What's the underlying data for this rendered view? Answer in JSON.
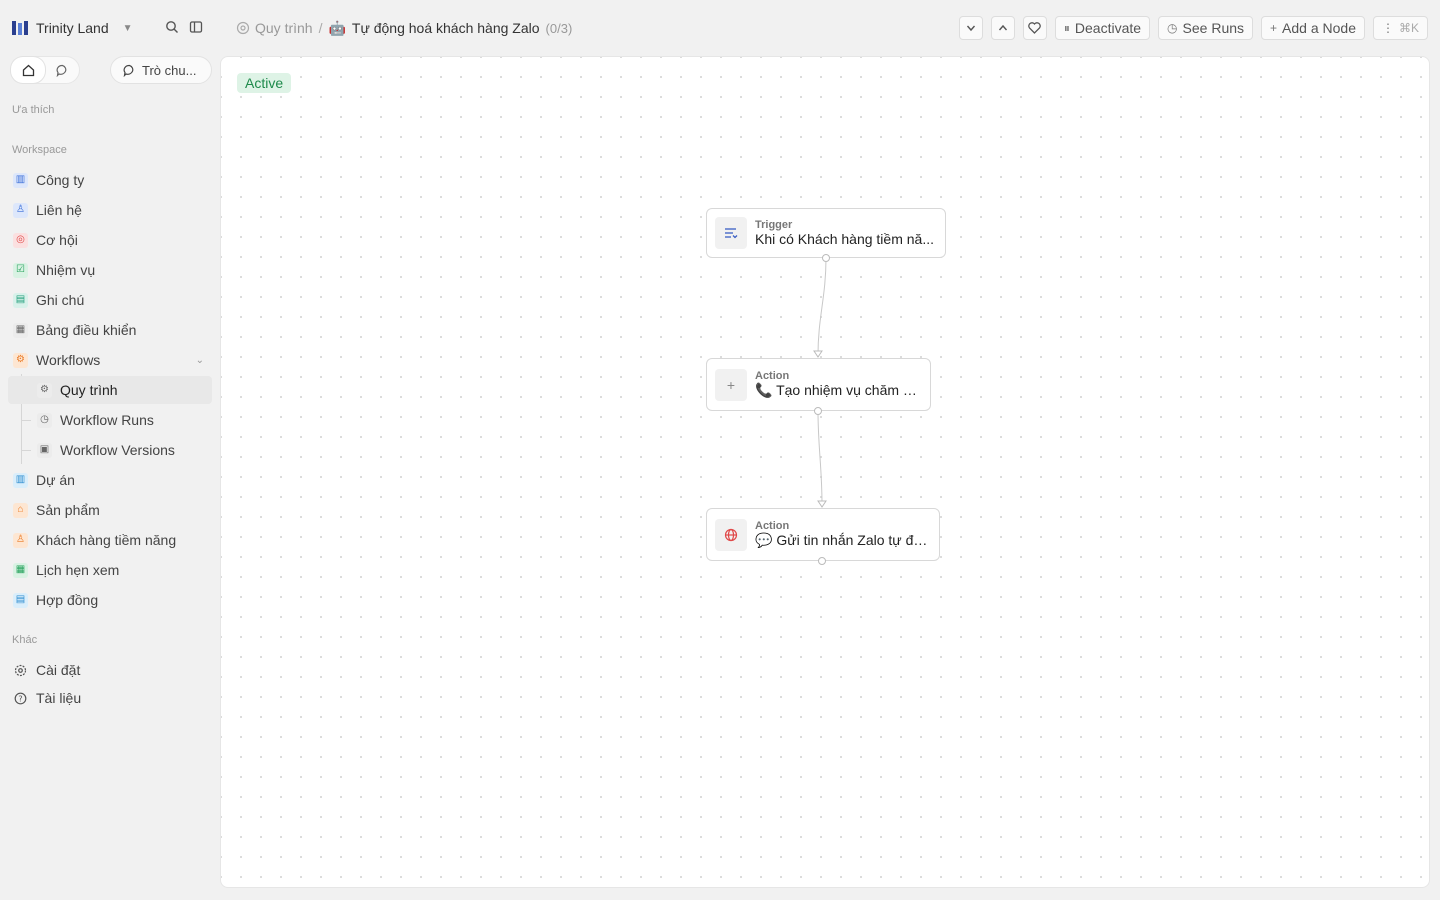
{
  "workspace": {
    "name": "Trinity Land",
    "logo_icon": "workspace-logo-icon"
  },
  "breadcrumb": {
    "parent": "Quy trình",
    "separator": "/",
    "title_emoji": "🤖",
    "title": "Tự động hoá khách hàng Zalo",
    "count": "(0/3)"
  },
  "toolbar": {
    "deactivate_label": "Deactivate",
    "see_runs_label": "See Runs",
    "add_node_label": "Add a Node",
    "shortcut": "⌘K"
  },
  "sidebar": {
    "chat_label": "Trò chu...",
    "favorites_label": "Ưa thích",
    "workspace_label": "Workspace",
    "other_label": "Khác",
    "items": [
      {
        "label": "Công ty",
        "icon": "building-icon",
        "color": "#3b6fd8"
      },
      {
        "label": "Liên hệ",
        "icon": "user-icon",
        "color": "#3b6fd8"
      },
      {
        "label": "Cơ hội",
        "icon": "target-icon",
        "color": "#e04848"
      },
      {
        "label": "Nhiệm vụ",
        "icon": "checkbox-icon",
        "color": "#23a15a"
      },
      {
        "label": "Ghi chú",
        "icon": "note-icon",
        "color": "#1f9d7a"
      },
      {
        "label": "Bảng điều khiển",
        "icon": "dashboard-icon",
        "color": "#666666"
      },
      {
        "label": "Workflows",
        "icon": "workflow-icon",
        "color": "#ea7b27"
      },
      {
        "label": "Quy trình",
        "icon": "settings-icon"
      },
      {
        "label": "Workflow Runs",
        "icon": "history-icon"
      },
      {
        "label": "Workflow Versions",
        "icon": "versions-icon"
      },
      {
        "label": "Dự án",
        "icon": "building-icon",
        "color": "#2c8ccf"
      },
      {
        "label": "Sản phẩm",
        "icon": "home-icon",
        "color": "#ea7b27"
      },
      {
        "label": "Khách hàng tiềm năng",
        "icon": "user-star-icon",
        "color": "#ea7b27"
      },
      {
        "label": "Lịch hẹn xem",
        "icon": "calendar-icon",
        "color": "#23a15a"
      },
      {
        "label": "Hợp đồng",
        "icon": "file-icon",
        "color": "#2c8ccf"
      }
    ],
    "other_items": [
      {
        "label": "Cài đặt",
        "icon": "settings-icon"
      },
      {
        "label": "Tài liệu",
        "icon": "help-icon"
      }
    ]
  },
  "canvas": {
    "status": "Active",
    "status_color": "#1e8a4b",
    "nodes": [
      {
        "type": "Trigger",
        "label": "Khi có Khách hàng tiềm nă...",
        "icon": "trigger-list-icon"
      },
      {
        "type": "Action",
        "label": "📞 Tạo nhiệm vụ chăm sóc",
        "icon": "plus-icon"
      },
      {
        "type": "Action",
        "label": "💬 Gửi tin nhắn Zalo tự động",
        "icon": "globe-icon"
      }
    ]
  }
}
